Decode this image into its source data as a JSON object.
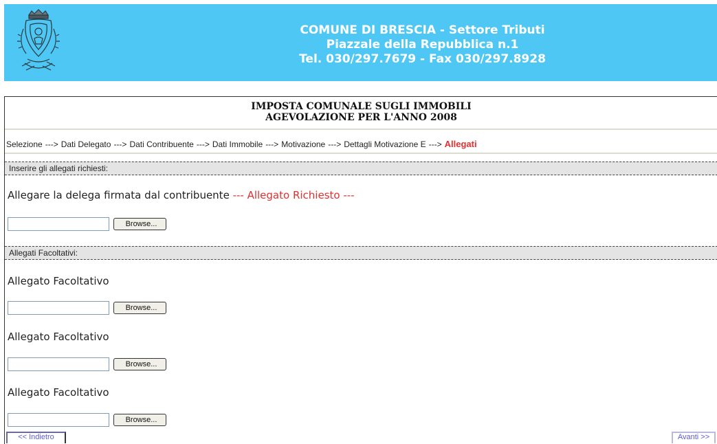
{
  "header": {
    "line1": "COMUNE DI BRESCIA - Settore Tributi",
    "line2": "Piazzale della Repubblica n.1",
    "line3": "Tel. 030/297.7679 - Fax 030/297.8928"
  },
  "title": {
    "line1": "IMPOSTA COMUNALE SUGLI IMMOBILI",
    "line2": "AGEVOLAZIONE PER L'ANNO 2008"
  },
  "breadcrumb": {
    "sep": "--->",
    "steps": [
      "Selezione",
      "Dati Delegato",
      "Dati Contribuente",
      "Dati Immobile",
      "Motivazione",
      "Dettagli Motivazione E"
    ],
    "current": "Allegati"
  },
  "required_section": {
    "heading": "Inserire gli allegati richiesti:",
    "field_label": "Allegare la delega firmata dal contribuente",
    "required_note": "--- Allegato Richiesto ---",
    "browse_label": "Browse..."
  },
  "optional_section": {
    "heading": "Allegati Facoltativi:",
    "fields": [
      {
        "label": "Allegato Facoltativo",
        "browse_label": "Browse..."
      },
      {
        "label": "Allegato Facoltativo",
        "browse_label": "Browse..."
      },
      {
        "label": "Allegato Facoltativo",
        "browse_label": "Browse..."
      }
    ]
  },
  "nav": {
    "prev_label": "<< Indietro",
    "next_label": "Avanti >>"
  },
  "colors": {
    "header_bg": "#4ec7f4",
    "current_step": "#e03030",
    "required_note": "#e03030",
    "nav_text": "#5a5adc"
  }
}
